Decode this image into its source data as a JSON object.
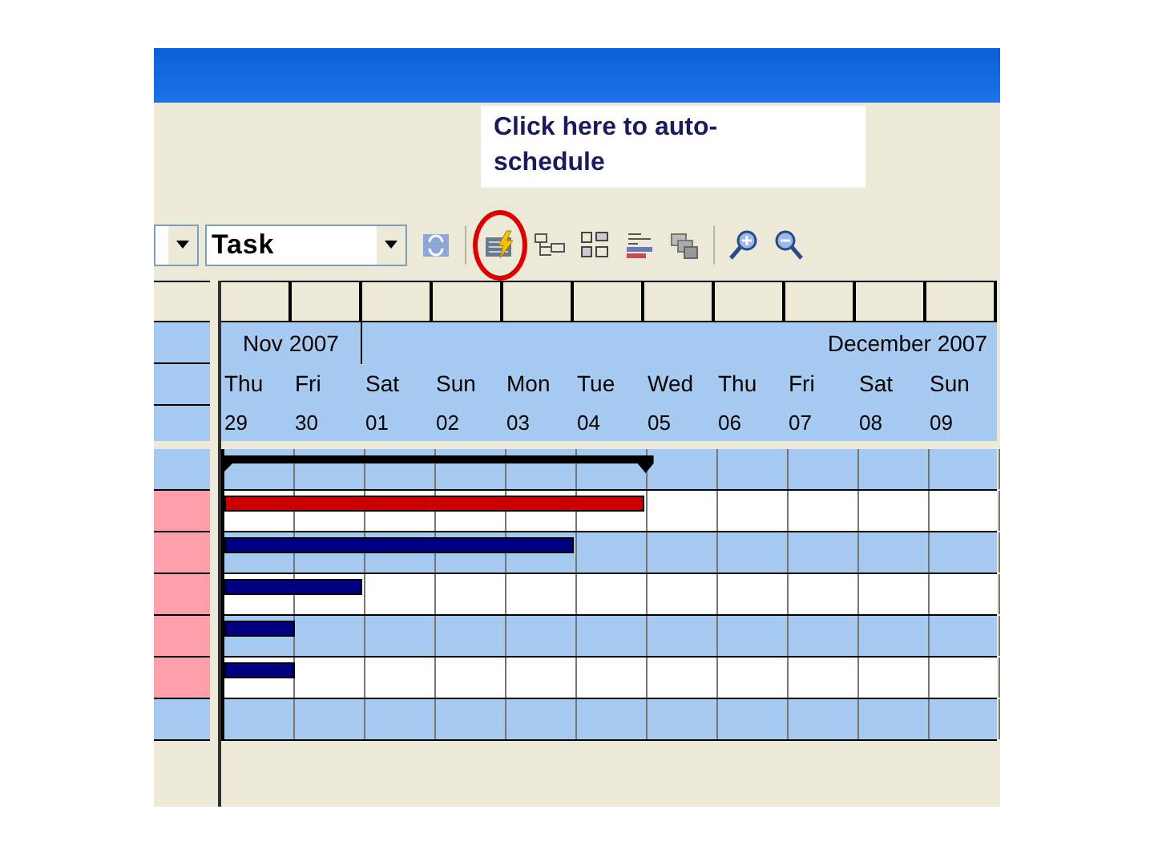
{
  "callout": {
    "text": "Click here to auto-schedule"
  },
  "toolbar": {
    "view_select": {
      "value": "Task"
    }
  },
  "timeline": {
    "months": [
      {
        "label": "Nov 2007"
      },
      {
        "label": "December 2007"
      }
    ],
    "days": [
      {
        "weekday": "Thu",
        "date": "29"
      },
      {
        "weekday": "Fri",
        "date": "30"
      },
      {
        "weekday": "Sat",
        "date": "01"
      },
      {
        "weekday": "Sun",
        "date": "02"
      },
      {
        "weekday": "Mon",
        "date": "03"
      },
      {
        "weekday": "Tue",
        "date": "04"
      },
      {
        "weekday": "Wed",
        "date": "05"
      },
      {
        "weekday": "Thu",
        "date": "06"
      },
      {
        "weekday": "Fri",
        "date": "07"
      },
      {
        "weekday": "Sat",
        "date": "08"
      },
      {
        "weekday": "Sun",
        "date": "09"
      }
    ]
  },
  "rows": [
    {
      "kind": "summary"
    },
    {
      "kind": "critical"
    },
    {
      "kind": "task"
    },
    {
      "kind": "task"
    },
    {
      "kind": "task"
    },
    {
      "kind": "task"
    },
    {
      "kind": "empty"
    }
  ]
}
